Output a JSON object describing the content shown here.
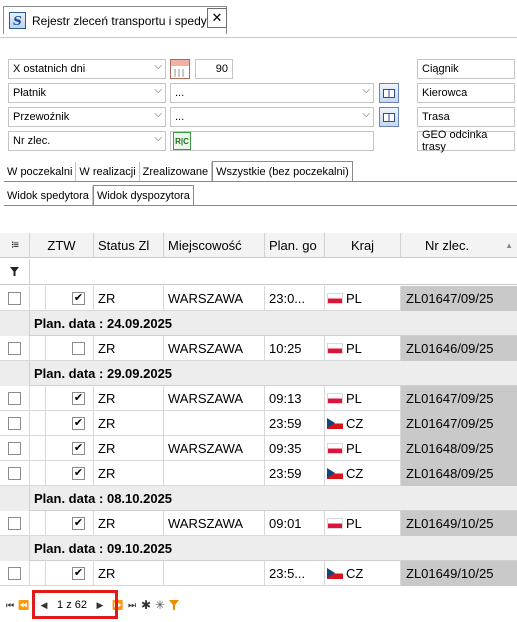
{
  "window": {
    "tab_title": "Rejestr zleceń transportu i spedycji",
    "close_glyph": "✕",
    "app_icon": "S"
  },
  "filters": {
    "period": {
      "value": "X ostatnich dni",
      "days": "90"
    },
    "payer": {
      "value": "Płatnik",
      "detail": "..."
    },
    "carrier": {
      "value": "Przewoźnik",
      "detail": "..."
    },
    "order_no": {
      "value": "Nr zlec.",
      "detail": ""
    },
    "side_buttons": [
      "Ciągnik",
      "Kierowca",
      "Trasa",
      "GEO odcinka trasy"
    ],
    "rc_icon_text": "R|C"
  },
  "status_tabs": [
    {
      "label": "W poczekalni",
      "active": false
    },
    {
      "label": "W realizacji",
      "active": false
    },
    {
      "label": "Zrealizowane",
      "active": false
    },
    {
      "label": "Wszystkie (bez poczekalni)",
      "active": true
    }
  ],
  "view_tabs": [
    {
      "label": "Widok spedytora",
      "active": false
    },
    {
      "label": "Widok dyspozytora",
      "active": true
    }
  ],
  "grid": {
    "columns": [
      "ZTW",
      "Status Zl",
      "Miejscowość",
      "Plan. go",
      "Kraj",
      "Nr zlec."
    ],
    "sort_indicator": "▲",
    "filter_icon": "funnel-icon",
    "rows": [
      {
        "kind": "row",
        "ztw": true,
        "status": "ZR",
        "city": "WARSZAWA",
        "time": "23:0...",
        "country": "PL",
        "order": "ZL01647/09/25"
      },
      {
        "kind": "group",
        "label": "Plan. data : 24.09.2025"
      },
      {
        "kind": "row",
        "ztw": false,
        "status": "ZR",
        "city": "WARSZAWA",
        "time": "10:25",
        "country": "PL",
        "order": "ZL01646/09/25"
      },
      {
        "kind": "group",
        "label": "Plan. data : 29.09.2025"
      },
      {
        "kind": "row",
        "ztw": true,
        "status": "ZR",
        "city": "WARSZAWA",
        "time": "09:13",
        "country": "PL",
        "order": "ZL01647/09/25"
      },
      {
        "kind": "row",
        "ztw": true,
        "status": "ZR",
        "city": "",
        "time": "23:59",
        "country": "CZ",
        "order": "ZL01647/09/25"
      },
      {
        "kind": "row",
        "ztw": true,
        "status": "ZR",
        "city": "WARSZAWA",
        "time": "09:35",
        "country": "PL",
        "order": "ZL01648/09/25"
      },
      {
        "kind": "row",
        "ztw": true,
        "status": "ZR",
        "city": "",
        "time": "23:59",
        "country": "CZ",
        "order": "ZL01648/09/25"
      },
      {
        "kind": "group",
        "label": "Plan. data : 08.10.2025"
      },
      {
        "kind": "row",
        "ztw": true,
        "status": "ZR",
        "city": "WARSZAWA",
        "time": "09:01",
        "country": "PL",
        "order": "ZL01649/10/25"
      },
      {
        "kind": "group",
        "label": "Plan. data : 09.10.2025"
      },
      {
        "kind": "row",
        "ztw": true,
        "status": "ZR",
        "city": "",
        "time": "23:5...",
        "country": "CZ",
        "order": "ZL01649/10/25"
      }
    ]
  },
  "pager": {
    "page_text": "1 z 62",
    "buttons": [
      "⏮",
      "⏪",
      "◀",
      "▶",
      "⏩",
      "⏭",
      "✱",
      "✳",
      "▼"
    ],
    "highlight_color": "#e01b1b"
  }
}
